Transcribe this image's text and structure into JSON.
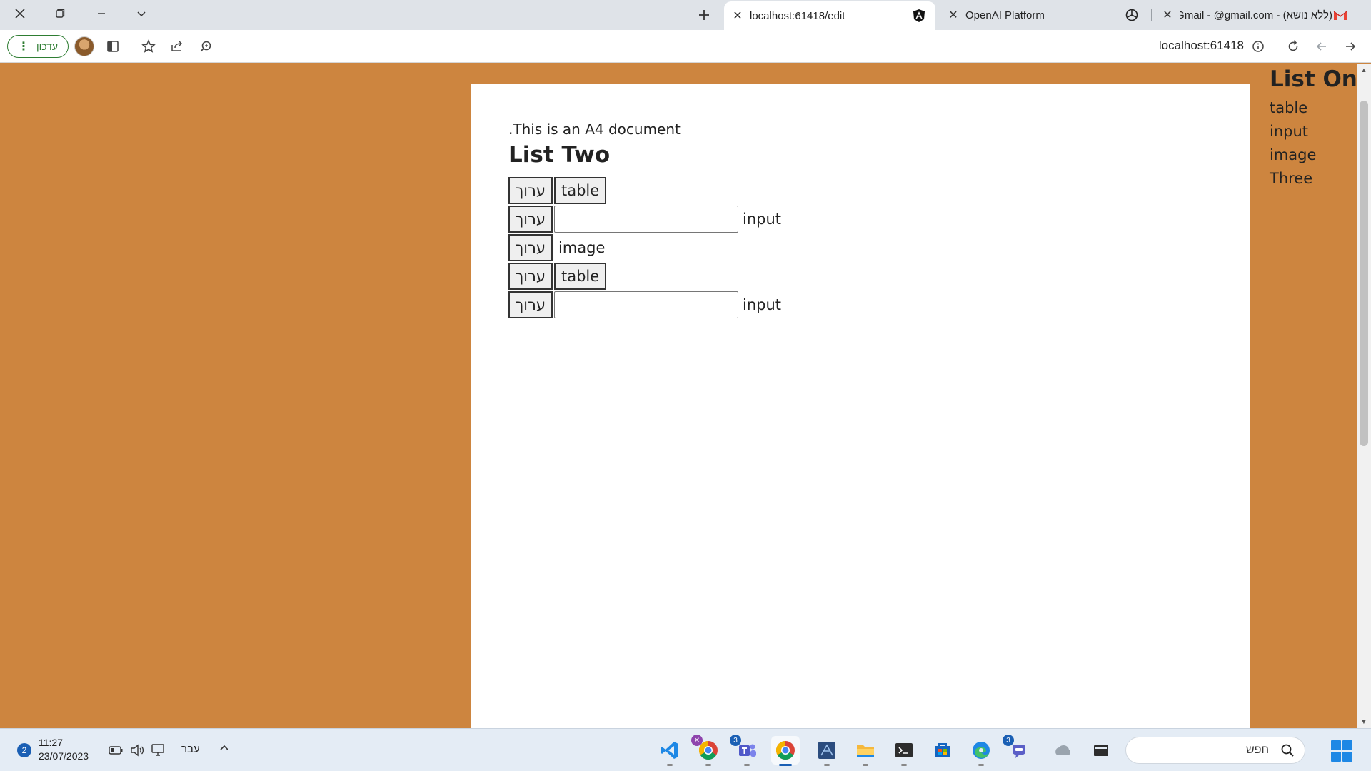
{
  "tabs": [
    {
      "title": "localhost:61418/edit",
      "active": true,
      "favicon": "angular-icon"
    },
    {
      "title": "OpenAI Platform",
      "active": false,
      "favicon": "openai-icon"
    },
    {
      "title": "(ללא נושא) - Gmail - @gmail.com",
      "active": false,
      "favicon": "gmail-icon"
    }
  ],
  "toolbar": {
    "update_label": "עדכון",
    "url": "localhost:61418"
  },
  "document": {
    "intro": ".This is an A4 document",
    "list_two_title": "List Two",
    "edit_label": "ערוך",
    "items": [
      {
        "type": "table",
        "label": "table"
      },
      {
        "type": "input",
        "label": "input",
        "value": ""
      },
      {
        "type": "image",
        "label": "image"
      },
      {
        "type": "table",
        "label": "table"
      },
      {
        "type": "input",
        "label": "input",
        "value": ""
      }
    ]
  },
  "list_one": {
    "title": "List One",
    "items": [
      "table",
      "input",
      "image",
      "Three"
    ]
  },
  "taskbar": {
    "notification_count": "2",
    "time": "11:27",
    "date": "23/07/2023",
    "language": "עבר",
    "search_placeholder": "חפש",
    "app_badges": {
      "teams": "3",
      "chrome_profile": "3"
    }
  },
  "colors": {
    "page_background": "#cd853f",
    "document": "#ffffff",
    "update_accent": "#2e7d32"
  }
}
